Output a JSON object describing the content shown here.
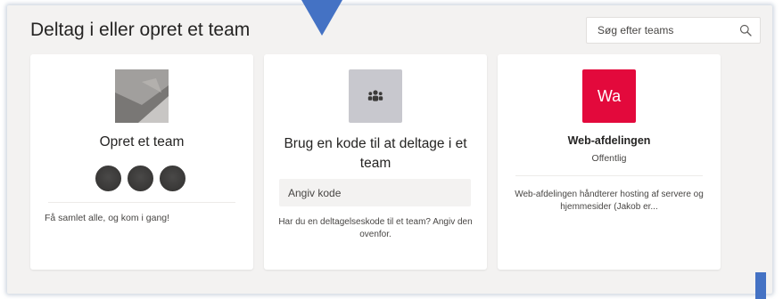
{
  "header": {
    "title": "Deltag i eller opret et team",
    "search_placeholder": "Søg efter teams",
    "search_icon": "search-icon"
  },
  "cards": {
    "create": {
      "title": "Opret et team",
      "description": "Få samlet alle, og kom i gang!",
      "image_icon": "team-placeholder-image"
    },
    "code": {
      "title": "Brug en kode til at deltage i et team",
      "input_placeholder": "Angiv kode",
      "help_text": "Har du en deltagelseskode til et team? Angiv den ovenfor.",
      "icon": "people-icon"
    },
    "team": {
      "tile_text": "Wa",
      "name": "Web-afdelingen",
      "visibility": "Offentlig",
      "description": "Web-afdelingen håndterer hosting af servere og hjemmesider (Jakob er...",
      "tile_color": "#e3093c"
    }
  },
  "colors": {
    "background": "#f3f2f1",
    "card": "#ffffff",
    "accent_arrow": "#4472c4",
    "avatar": "#3b3a39"
  }
}
